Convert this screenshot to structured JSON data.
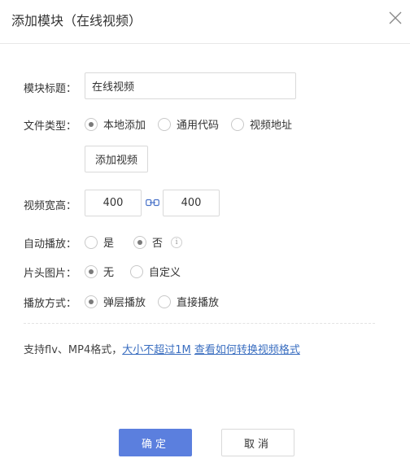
{
  "dialog": {
    "title": "添加模块（在线视频）",
    "close_icon": "close-icon"
  },
  "form": {
    "module_title": {
      "label": "模块标题：",
      "value": "在线视频"
    },
    "file_type": {
      "label": "文件类型：",
      "options": [
        "本地添加",
        "通用代码",
        "视频地址"
      ],
      "selected": "本地添加"
    },
    "add_video_button": "添加视频",
    "video_size": {
      "label": "视频宽高：",
      "width": "400",
      "height": "400",
      "link_icon": "link-icon"
    },
    "autoplay": {
      "label": "自动播放：",
      "options": [
        "是",
        "否"
      ],
      "selected": "否",
      "info_icon": "i"
    },
    "header_image": {
      "label": "片头图片：",
      "options": [
        "无",
        "自定义"
      ],
      "selected": "无"
    },
    "play_mode": {
      "label": "播放方式：",
      "options": [
        "弹层播放",
        "直接播放"
      ],
      "selected": "弹层播放"
    }
  },
  "note": {
    "text": "支持flv、MP4格式，",
    "link1": "大小不超过1M",
    "link2": "查看如何转换视频格式"
  },
  "footer": {
    "confirm": "确定",
    "cancel": "取消"
  },
  "colors": {
    "primary": "#5b7fde",
    "link": "#3a6ec0",
    "border": "#d9d9d9"
  }
}
